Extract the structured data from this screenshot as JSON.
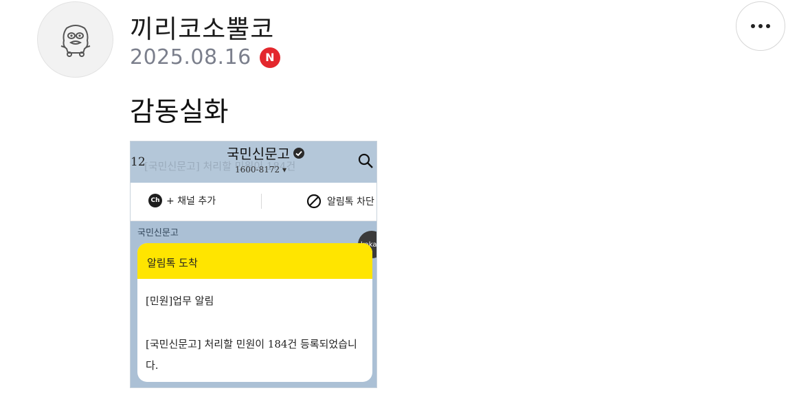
{
  "post": {
    "author": "끼리코소뿔코",
    "date": "2025.08.16",
    "badge": "N",
    "badge_color": "#e3272d",
    "text": "감동실화",
    "avatar_icon": "character-avatar-icon",
    "more_icon": "more-dots-icon"
  },
  "attachment": {
    "header_time": "12",
    "header_faded_text": "[국민신문고] 처리할 민원이 184건",
    "channel_title": "국민신문고",
    "channel_phone": "1600-8172 ▾",
    "add_channel_label": "+ 채널 추가",
    "add_channel_icon_text": "Ch",
    "block_label": "알림톡 차단",
    "sender_name": "국민신문고",
    "kakao_label": "kaka",
    "bubble_title": "알림톡 도착",
    "bubble_line1": "[민원]업무 알림",
    "bubble_line2": "[국민신문고] 처리할 민원이 184건 등록되었습니다.",
    "bubble_header_color": "#ffe500"
  }
}
